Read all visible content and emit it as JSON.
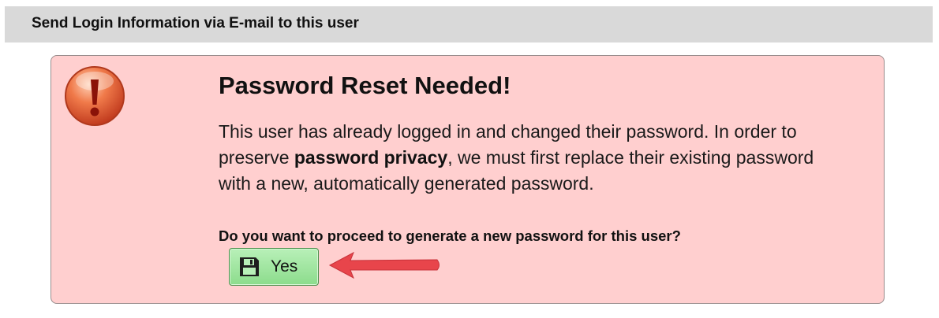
{
  "header": {
    "title": "Send Login Information via E-mail to this user"
  },
  "alert": {
    "title": "Password Reset Needed!",
    "body_part1": "This user has already logged in and changed their password. In order to preserve ",
    "body_bold": "password privacy",
    "body_part2": ", we must first replace their existing password with a new, automatically generated password.",
    "question": "Do you want to proceed to generate a new password for this user?",
    "icon": "exclamation-icon"
  },
  "yes_button": {
    "label": "Yes",
    "icon": "save-icon"
  },
  "colors": {
    "panel_background": "#ffcfcf",
    "header_background": "#d9d9d9",
    "button_green": "#8cdc8c",
    "arrow_red": "#e8454b"
  }
}
